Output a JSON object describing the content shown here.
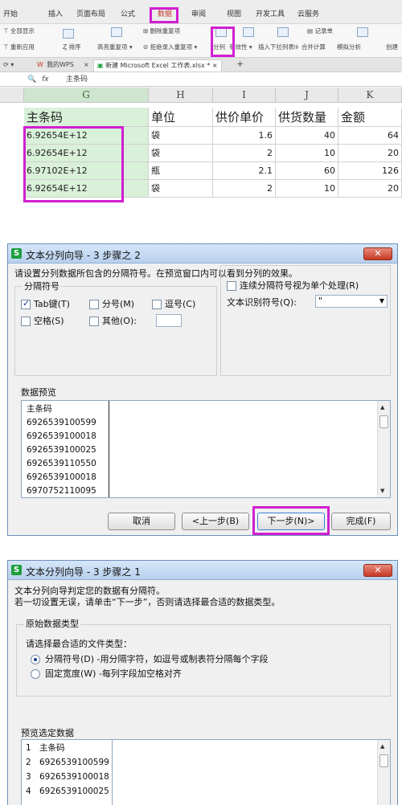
{
  "menu": {
    "items": [
      "开始",
      "插入",
      "页面布局",
      "公式",
      "数据",
      "审阅",
      "视图",
      "开发工具",
      "云服务"
    ],
    "active": "数据"
  },
  "ribbon": {
    "show_all": "全部显示",
    "reapply": "重新应用",
    "sort": "排序",
    "highlight_dup": "高亮重复项",
    "remove_dup": "删除重复项",
    "reject_dup": "拒绝录入重复项",
    "split": "分列",
    "validity": "有效性",
    "insert_dropdown": "插入下拉列表",
    "record": "记录单",
    "merge_calc": "合并计算",
    "simulate": "模拟分析",
    "create": "创建"
  },
  "tabs": {
    "wps": "我的WPS",
    "file": "新建 Microsoft Excel 工作表.xlsx *",
    "close": "×",
    "new_tab": "+"
  },
  "formula_bar": {
    "fx": "fx",
    "content": "主条码"
  },
  "sheet": {
    "columns": [
      "G",
      "H",
      "I",
      "J",
      "K"
    ],
    "headers": [
      "主条码",
      "单位",
      "供价单价",
      "供货数量",
      "金额"
    ],
    "rows": [
      [
        "6.92654E+12",
        "袋",
        "1.6",
        "40",
        "64"
      ],
      [
        "6.92654E+12",
        "袋",
        "2",
        "10",
        "20"
      ],
      [
        "6.97102E+12",
        "瓶",
        "2.1",
        "60",
        "126"
      ],
      [
        "6.92654E+12",
        "袋",
        "2",
        "10",
        "20"
      ]
    ]
  },
  "wizard2": {
    "logo": "S",
    "title": "文本分列向导 - 3 步骤之 2",
    "close": "✕",
    "instruction": "请设置分列数据所包含的分隔符号。在预览窗口内可以看到分列的效果。",
    "group_label": "分隔符号",
    "tab": "Tab键(T)",
    "semicolon": "分号(M)",
    "comma": "逗号(C)",
    "space": "空格(S)",
    "other": "其他(O):",
    "consecutive": "连续分隔符号视为单个处理(R)",
    "qualifier_label": "文本识别符号(Q):",
    "qualifier_value": "\"",
    "preview_label": "数据预览",
    "preview_lines": [
      "主条码",
      "6926539100599",
      "6926539100018",
      "6926539100025",
      "6926539110550",
      "6926539100018",
      "6970752110095"
    ],
    "cancel": "取消",
    "prev": "<上一步(B)",
    "next": "下一步(N)>",
    "finish": "完成(F)"
  },
  "wizard1": {
    "logo": "S",
    "title": "文本分列向导 - 3 步骤之 1",
    "close": "✕",
    "line1": "文本分列向导判定您的数据有分隔符。",
    "line2": "若一切设置无误，请单击“下一步”，否则请选择最合适的数据类型。",
    "group_label": "原始数据类型",
    "choose": "请选择最合适的文件类型：",
    "delimited": "分隔符号(D)  -用分隔字符，如逗号或制表符分隔每个字段",
    "fixed": "固定宽度(W)  -每列字段加空格对齐",
    "preview_label": "预览选定数据",
    "preview_rows": [
      {
        "n": "1",
        "v": "主条码"
      },
      {
        "n": "2",
        "v": "6926539100599"
      },
      {
        "n": "3",
        "v": "6926539100018"
      },
      {
        "n": "4",
        "v": "6926539100025"
      }
    ]
  },
  "colors": {
    "highlight": "#d11fd1",
    "selected_cell": "#d9f0d9",
    "close_button": "#c63a26",
    "logo_green": "#1e9e3c"
  }
}
